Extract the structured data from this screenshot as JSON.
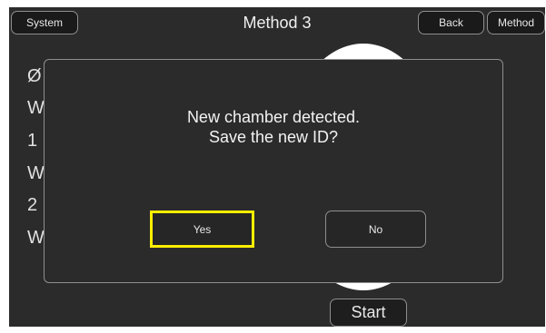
{
  "header": {
    "system_label": "System",
    "title": "Method 3",
    "back_label": "Back",
    "method_label": "Method"
  },
  "background_lines": [
    "Ø",
    "W",
    "1",
    "W",
    "2",
    "W"
  ],
  "dialog": {
    "message_line1": "New chamber detected.",
    "message_line2": "Save the new ID?",
    "yes_label": "Yes",
    "no_label": "No"
  },
  "footer": {
    "start_label": "Start"
  },
  "colors": {
    "screen_bg": "#2b2b2b",
    "focus_highlight": "#ffee00",
    "button_border": "#8e8e8e"
  }
}
